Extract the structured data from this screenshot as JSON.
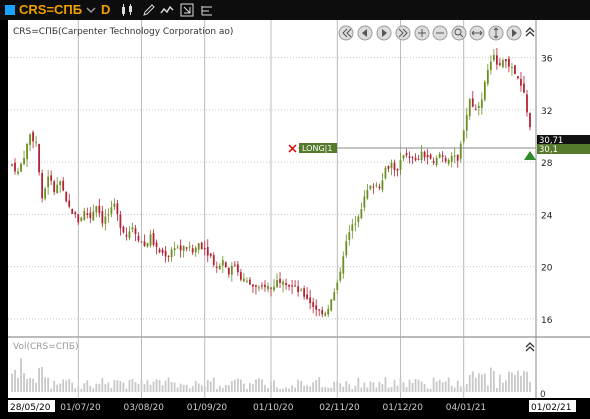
{
  "toolbar": {
    "symbol": "CRS=СПБ",
    "period": "D",
    "icons": [
      "chevron-down-icon",
      "candlestick-icon",
      "pen-icon",
      "chart-style-icon",
      "cursor-icon",
      "levels-icon"
    ]
  },
  "chart": {
    "title": "CRS=СПБ(Carpenter Technology Corporation ao)",
    "volume_label": "Vol(CRS=СПБ)",
    "volume_axis_label": "0",
    "order_label": "LONG|1",
    "current_price_label": "30,71",
    "order_price_label": "30,1",
    "colors": {
      "up": "#6b8e23",
      "down": "#b22234",
      "background": "#ffffff",
      "grid": "#c8c8c8"
    }
  },
  "chart_data": {
    "type": "candlestick",
    "title": "CRS=СПБ(Carpenter Technology Corporation ao)",
    "y_ticks": [
      "16",
      "20",
      "24",
      "28",
      "32",
      "36"
    ],
    "ylim": [
      15,
      37.5
    ],
    "x_ticks": [
      "28/05/20",
      "01/07/20",
      "03/08/20",
      "01/09/20",
      "01/10/20",
      "02/11/20",
      "01/12/20",
      "04/01/21",
      "01/02/21"
    ],
    "x_tick_index": [
      0,
      22,
      43,
      64,
      86,
      108,
      129,
      150,
      170
    ],
    "close_path": [
      [
        0,
        27.8
      ],
      [
        2,
        27.2
      ],
      [
        4,
        28.5
      ],
      [
        6,
        30.1
      ],
      [
        8,
        29.5
      ],
      [
        10,
        25.0
      ],
      [
        12,
        27.0
      ],
      [
        14,
        25.8
      ],
      [
        16,
        26.5
      ],
      [
        18,
        24.8
      ],
      [
        20,
        24.2
      ],
      [
        22,
        23.5
      ],
      [
        24,
        24.2
      ],
      [
        26,
        23.8
      ],
      [
        28,
        24.8
      ],
      [
        30,
        23.5
      ],
      [
        32,
        24.0
      ],
      [
        34,
        24.6
      ],
      [
        36,
        23.2
      ],
      [
        38,
        22.4
      ],
      [
        40,
        23.1
      ],
      [
        42,
        22.2
      ],
      [
        44,
        21.6
      ],
      [
        46,
        22.3
      ],
      [
        48,
        21.3
      ],
      [
        50,
        21.0
      ],
      [
        52,
        20.9
      ],
      [
        54,
        21.6
      ],
      [
        56,
        21.3
      ],
      [
        58,
        21.5
      ],
      [
        60,
        21.1
      ],
      [
        62,
        21.8
      ],
      [
        64,
        21.4
      ],
      [
        66,
        20.8
      ],
      [
        68,
        19.9
      ],
      [
        70,
        20.5
      ],
      [
        72,
        19.6
      ],
      [
        74,
        20.2
      ],
      [
        76,
        19.2
      ],
      [
        78,
        18.8
      ],
      [
        80,
        18.5
      ],
      [
        82,
        18.2
      ],
      [
        84,
        18.6
      ],
      [
        86,
        18.3
      ],
      [
        88,
        18.9
      ],
      [
        90,
        19.1
      ],
      [
        92,
        18.6
      ],
      [
        94,
        18.3
      ],
      [
        96,
        18.0
      ],
      [
        98,
        17.6
      ],
      [
        100,
        17.0
      ],
      [
        102,
        16.6
      ],
      [
        104,
        16.5
      ],
      [
        106,
        17.4
      ],
      [
        108,
        18.6
      ],
      [
        110,
        21.0
      ],
      [
        112,
        22.6
      ],
      [
        114,
        23.5
      ],
      [
        116,
        24.6
      ],
      [
        118,
        25.8
      ],
      [
        120,
        26.3
      ],
      [
        122,
        26.2
      ],
      [
        124,
        27.5
      ],
      [
        126,
        27.9
      ],
      [
        128,
        27.2
      ],
      [
        130,
        28.7
      ],
      [
        132,
        28.5
      ],
      [
        134,
        28.0
      ],
      [
        136,
        28.6
      ],
      [
        138,
        28.4
      ],
      [
        140,
        27.8
      ],
      [
        142,
        28.6
      ],
      [
        144,
        28.2
      ],
      [
        146,
        28.5
      ],
      [
        148,
        28.0
      ],
      [
        150,
        30.6
      ],
      [
        152,
        32.8
      ],
      [
        154,
        32.0
      ],
      [
        156,
        33.0
      ],
      [
        158,
        35.0
      ],
      [
        160,
        36.0
      ],
      [
        162,
        35.4
      ],
      [
        164,
        35.8
      ],
      [
        166,
        35.1
      ],
      [
        168,
        34.3
      ],
      [
        170,
        33.2
      ],
      [
        172,
        30.7
      ]
    ],
    "volume_series": {
      "name": "Vol(CRS=СПБ)"
    }
  }
}
